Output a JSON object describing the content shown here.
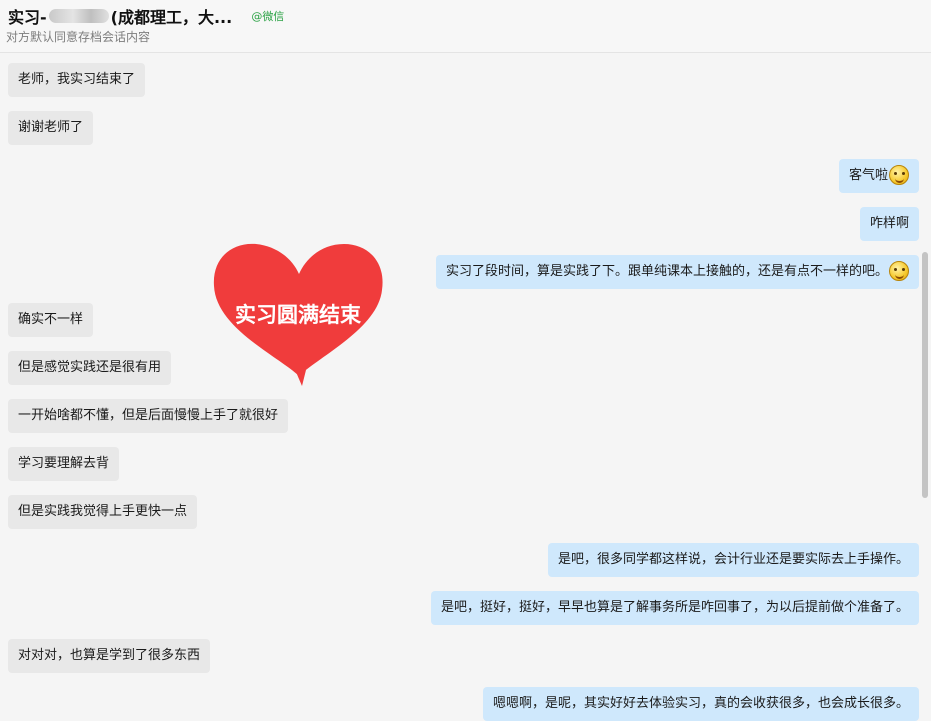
{
  "header": {
    "title_prefix": "实习-",
    "title_suffix": "(成都理工，大...",
    "source": "@微信",
    "subtitle": "对方默认同意存档会话内容"
  },
  "sticker": {
    "text": "实习圆满结束",
    "color": "#f03c3c"
  },
  "messages": [
    {
      "side": "left",
      "text": "老师，我实习结束了"
    },
    {
      "side": "left",
      "text": "谢谢老师了"
    },
    {
      "side": "right",
      "text": "客气啦",
      "emoji": "smile-emoji"
    },
    {
      "side": "right",
      "text": "咋样啊"
    },
    {
      "side": "right",
      "text": "实习了段时间，算是实践了下。跟单纯课本上接触的，还是有点不一样的吧。",
      "emoji": "smile-emoji"
    },
    {
      "side": "left",
      "text": "确实不一样"
    },
    {
      "side": "left",
      "text": "但是感觉实践还是很有用"
    },
    {
      "side": "left",
      "text": "一开始啥都不懂，但是后面慢慢上手了就很好"
    },
    {
      "side": "left",
      "text": "学习要理解去背"
    },
    {
      "side": "left",
      "text": "但是实践我觉得上手更快一点"
    },
    {
      "side": "right",
      "text": "是吧，很多同学都这样说，会计行业还是要实际去上手操作。"
    },
    {
      "side": "right",
      "text": "是吧，挺好，挺好，早早也算是了解事务所是咋回事了，为以后提前做个准备了。"
    },
    {
      "side": "left",
      "text": "对对对，也算是学到了很多东西"
    },
    {
      "side": "right",
      "text": "嗯嗯啊，是呢，其实好好去体验实习，真的会收获很多，也会成长很多。"
    }
  ]
}
